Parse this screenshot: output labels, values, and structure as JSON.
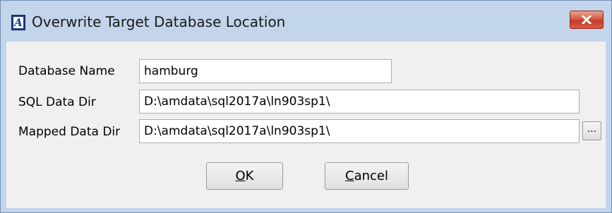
{
  "window": {
    "title": "Overwrite Target Database Location",
    "app_icon_letter": "A",
    "close_icon": "close-x-icon"
  },
  "form": {
    "database_name": {
      "label": "Database Name",
      "value": "hamburg"
    },
    "sql_data_dir": {
      "label": "SQL Data Dir",
      "value": "D:\\amdata\\sql2017a\\ln903sp1\\"
    },
    "mapped_data_dir": {
      "label": "Mapped Data Dir",
      "value": "D:\\amdata\\sql2017a\\ln903sp1\\",
      "browse_label": "..."
    }
  },
  "buttons": {
    "ok": {
      "mnemonic": "O",
      "rest": "K"
    },
    "cancel": {
      "mnemonic": "C",
      "rest": "ancel"
    }
  },
  "colors": {
    "frame": "#c3d5ea",
    "client": "#f0f0f0",
    "close_button": "#c83c28"
  }
}
